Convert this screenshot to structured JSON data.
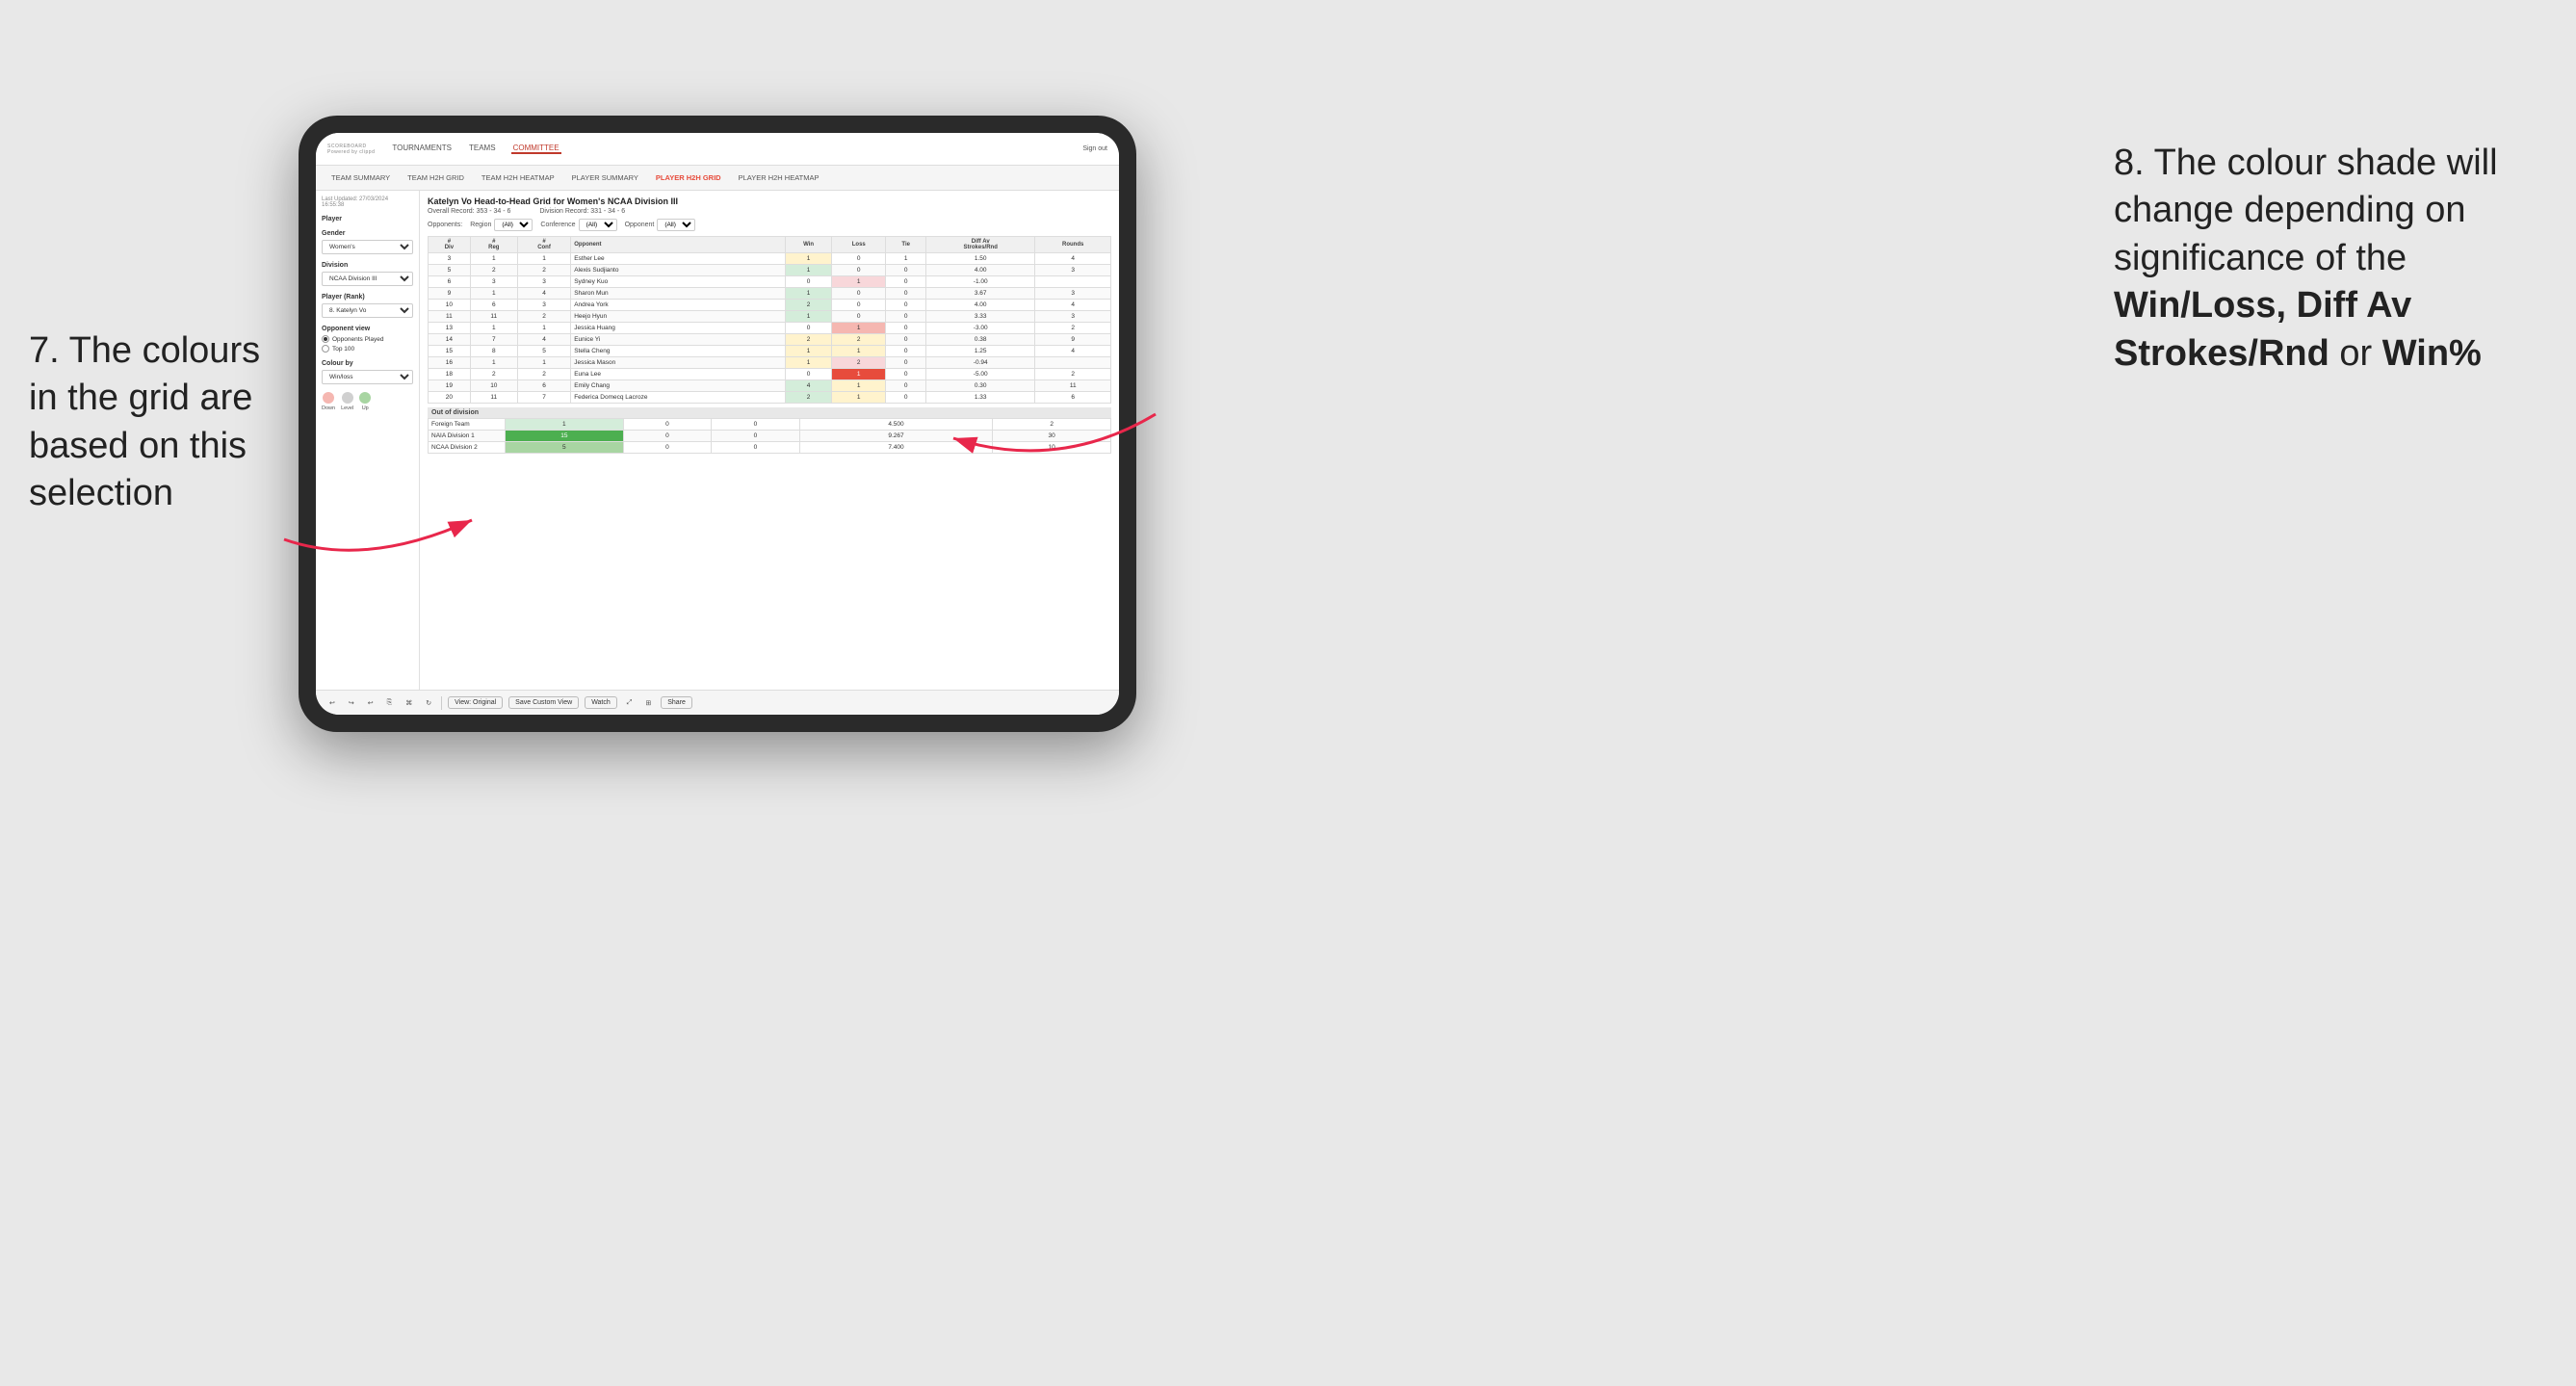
{
  "app": {
    "logo": "SCOREBOARD",
    "logo_sub": "Powered by clippd",
    "sign_out": "Sign out"
  },
  "nav": {
    "items": [
      "TOURNAMENTS",
      "TEAMS",
      "COMMITTEE"
    ],
    "active": "COMMITTEE"
  },
  "sub_nav": {
    "items": [
      "TEAM SUMMARY",
      "TEAM H2H GRID",
      "TEAM H2H HEATMAP",
      "PLAYER SUMMARY",
      "PLAYER H2H GRID",
      "PLAYER H2H HEATMAP"
    ],
    "active": "PLAYER H2H GRID"
  },
  "sidebar": {
    "meta": "Last Updated: 27/03/2024\n16:55:38",
    "player_label": "Player",
    "gender_label": "Gender",
    "gender_value": "Women's",
    "division_label": "Division",
    "division_value": "NCAA Division III",
    "player_rank_label": "Player (Rank)",
    "player_rank_value": "8. Katelyn Vo",
    "opponent_view_label": "Opponent view",
    "opponent_played": "Opponents Played",
    "top_100": "Top 100",
    "colour_by_label": "Colour by",
    "colour_by_value": "Win/loss",
    "legend_down": "Down",
    "legend_level": "Level",
    "legend_up": "Up"
  },
  "grid": {
    "title": "Katelyn Vo Head-to-Head Grid for Women's NCAA Division III",
    "overall_record": "Overall Record: 353 - 34 - 6",
    "division_record": "Division Record: 331 - 34 - 6",
    "filter_opponents": "Opponents:",
    "filter_region": "Region",
    "filter_conference": "Conference",
    "filter_opponent": "Opponent",
    "filter_all": "(All)",
    "headers": [
      "#\nDiv",
      "#\nReg",
      "#\nConf",
      "Opponent",
      "Win",
      "Loss",
      "Tie",
      "Diff Av\nStrokes/Rnd",
      "Rounds"
    ],
    "rows": [
      {
        "div": "3",
        "reg": "1",
        "conf": "1",
        "opponent": "Esther Lee",
        "win": "1",
        "loss": "0",
        "tie": "1",
        "diff": "1.50",
        "rounds": "4",
        "win_color": "yellow",
        "loss_color": "",
        "tie_color": ""
      },
      {
        "div": "5",
        "reg": "2",
        "conf": "2",
        "opponent": "Alexis Sudjianto",
        "win": "1",
        "loss": "0",
        "tie": "0",
        "diff": "4.00",
        "rounds": "3",
        "win_color": "green-light",
        "loss_color": "",
        "tie_color": ""
      },
      {
        "div": "6",
        "reg": "3",
        "conf": "3",
        "opponent": "Sydney Kuo",
        "win": "0",
        "loss": "1",
        "tie": "0",
        "diff": "-1.00",
        "rounds": "",
        "win_color": "",
        "loss_color": "red-light",
        "tie_color": ""
      },
      {
        "div": "9",
        "reg": "1",
        "conf": "4",
        "opponent": "Sharon Mun",
        "win": "1",
        "loss": "0",
        "tie": "0",
        "diff": "3.67",
        "rounds": "3",
        "win_color": "green-light",
        "loss_color": "",
        "tie_color": ""
      },
      {
        "div": "10",
        "reg": "6",
        "conf": "3",
        "opponent": "Andrea York",
        "win": "2",
        "loss": "0",
        "tie": "0",
        "diff": "4.00",
        "rounds": "4",
        "win_color": "green-light",
        "loss_color": "",
        "tie_color": ""
      },
      {
        "div": "11",
        "reg": "11",
        "conf": "2",
        "opponent": "Heejo Hyun",
        "win": "1",
        "loss": "0",
        "tie": "0",
        "diff": "3.33",
        "rounds": "3",
        "win_color": "green-light",
        "loss_color": "",
        "tie_color": ""
      },
      {
        "div": "13",
        "reg": "1",
        "conf": "1",
        "opponent": "Jessica Huang",
        "win": "0",
        "loss": "1",
        "tie": "0",
        "diff": "-3.00",
        "rounds": "2",
        "win_color": "",
        "loss_color": "red-med",
        "tie_color": ""
      },
      {
        "div": "14",
        "reg": "7",
        "conf": "4",
        "opponent": "Eunice Yi",
        "win": "2",
        "loss": "2",
        "tie": "0",
        "diff": "0.38",
        "rounds": "9",
        "win_color": "yellow",
        "loss_color": "yellow",
        "tie_color": ""
      },
      {
        "div": "15",
        "reg": "8",
        "conf": "5",
        "opponent": "Stella Cheng",
        "win": "1",
        "loss": "1",
        "tie": "0",
        "diff": "1.25",
        "rounds": "4",
        "win_color": "yellow",
        "loss_color": "yellow",
        "tie_color": ""
      },
      {
        "div": "16",
        "reg": "1",
        "conf": "1",
        "opponent": "Jessica Mason",
        "win": "1",
        "loss": "2",
        "tie": "0",
        "diff": "-0.94",
        "rounds": "",
        "win_color": "yellow",
        "loss_color": "red-light",
        "tie_color": ""
      },
      {
        "div": "18",
        "reg": "2",
        "conf": "2",
        "opponent": "Euna Lee",
        "win": "0",
        "loss": "1",
        "tie": "0",
        "diff": "-5.00",
        "rounds": "2",
        "win_color": "",
        "loss_color": "red-dark",
        "tie_color": ""
      },
      {
        "div": "19",
        "reg": "10",
        "conf": "6",
        "opponent": "Emily Chang",
        "win": "4",
        "loss": "1",
        "tie": "0",
        "diff": "0.30",
        "rounds": "11",
        "win_color": "green-light",
        "loss_color": "yellow",
        "tie_color": ""
      },
      {
        "div": "20",
        "reg": "11",
        "conf": "7",
        "opponent": "Federica Domecq Lacroze",
        "win": "2",
        "loss": "1",
        "tie": "0",
        "diff": "1.33",
        "rounds": "6",
        "win_color": "green-light",
        "loss_color": "yellow",
        "tie_color": ""
      }
    ],
    "out_of_division_label": "Out of division",
    "out_of_division_rows": [
      {
        "opponent": "Foreign Team",
        "win": "1",
        "loss": "0",
        "tie": "0",
        "diff": "4.500",
        "rounds": "2",
        "win_color": "green-light"
      },
      {
        "opponent": "NAIA Division 1",
        "win": "15",
        "loss": "0",
        "tie": "0",
        "diff": "9.267",
        "rounds": "30",
        "win_color": "green-dark"
      },
      {
        "opponent": "NCAA Division 2",
        "win": "5",
        "loss": "0",
        "tie": "0",
        "diff": "7.400",
        "rounds": "10",
        "win_color": "green-med"
      }
    ]
  },
  "toolbar": {
    "view_original": "View: Original",
    "save_custom": "Save Custom View",
    "watch": "Watch",
    "share": "Share"
  },
  "annotations": {
    "left_text": "7. The colours in the grid are based on this selection",
    "right_text": "8. The colour shade will change depending on significance of the Win/Loss, Diff Av Strokes/Rnd or Win%",
    "right_bold_parts": [
      "Win/Loss,",
      "Diff Av Strokes/Rnd",
      "Win%"
    ]
  }
}
